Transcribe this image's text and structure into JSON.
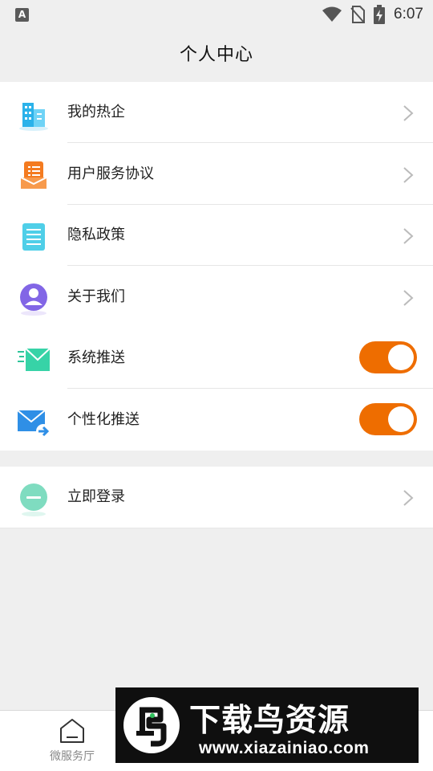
{
  "status_bar": {
    "left_icon_letter": "A",
    "time": "6:07",
    "icons": [
      "wifi-icon",
      "no-sim-icon",
      "battery-charging-icon"
    ]
  },
  "header": {
    "title": "个人中心"
  },
  "menu": {
    "items": [
      {
        "label": "我的热企",
        "icon": "building-icon",
        "type": "link"
      },
      {
        "label": "用户服务协议",
        "icon": "agreement-icon",
        "type": "link"
      },
      {
        "label": "隐私政策",
        "icon": "document-icon",
        "type": "link"
      },
      {
        "label": "关于我们",
        "icon": "user-circle-icon",
        "type": "link"
      },
      {
        "label": "系统推送",
        "icon": "mail-icon",
        "type": "toggle",
        "on": true
      },
      {
        "label": "个性化推送",
        "icon": "mail-forward-icon",
        "type": "toggle",
        "on": true
      }
    ]
  },
  "login": {
    "label": "立即登录",
    "icon": "minus-circle-icon"
  },
  "tabbar": {
    "home_label": "微服务厅",
    "home_icon": "home-icon"
  },
  "watermark": {
    "title": "下载鸟资源",
    "url": "www.xiazainiao.com"
  },
  "colors": {
    "accent": "#ee6d00",
    "background": "#efefef",
    "card": "#ffffff",
    "divider": "#e6e6e6"
  }
}
